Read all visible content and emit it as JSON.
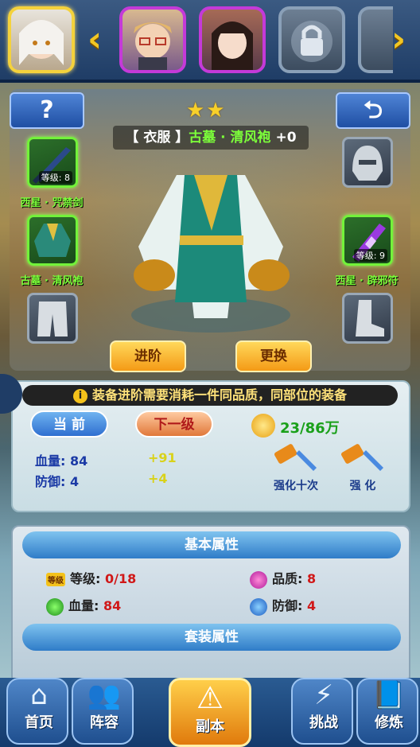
{
  "heroes": [
    {
      "name": "hero-white-hair",
      "state": "selected"
    },
    {
      "name": "hero-glasses",
      "state": "unlocked"
    },
    {
      "name": "hero-dark-hair",
      "state": "unlocked"
    },
    {
      "name": "hero-locked",
      "state": "locked"
    }
  ],
  "header": {
    "help_label": "?",
    "back_label": "⮌"
  },
  "equipment": {
    "stars": "★★",
    "slot_prefix": "【 衣服 】",
    "item_name": "古墓 · 清风袍",
    "plus_level": "+0",
    "left_slots": [
      {
        "name": "西星 · 咒禁剑",
        "level": "等级: 8"
      },
      {
        "name": "古墓 · 清风袍"
      }
    ],
    "right_slots": [
      {
        "name": "西星 · 辟邪符",
        "level": "等级: 9"
      }
    ],
    "advance_label": "进阶",
    "replace_label": "更换"
  },
  "info": {
    "notice": "装备进阶需要消耗一件同品质，同部位的装备",
    "tab_current": "当 前",
    "tab_next": "下一级",
    "cost": "23/86万",
    "hp_label": "血量: 84",
    "def_label": "防御: 4",
    "hp_gain": "+91",
    "def_gain": "+4",
    "strengthen_ten": "强化十次",
    "strengthen": "强 化"
  },
  "attributes": {
    "basic_title": "基本属性",
    "level_badge": "等级",
    "level_label": "等级: ",
    "level_value": "0/18",
    "quality_label": "品质: ",
    "quality_value": "8",
    "hp_label": "血量: ",
    "hp_value": "84",
    "def_label": "防御: ",
    "def_value": "4",
    "set_title": "套装属性"
  },
  "nav": {
    "home": "首页",
    "lineup": "阵容",
    "dungeon": "副本",
    "challenge": "挑战",
    "cultivate": "修炼"
  },
  "colors": {
    "accent_gold": "#f4d23c",
    "green_item": "#73f23a",
    "blue_nav": "#2a5b92"
  }
}
